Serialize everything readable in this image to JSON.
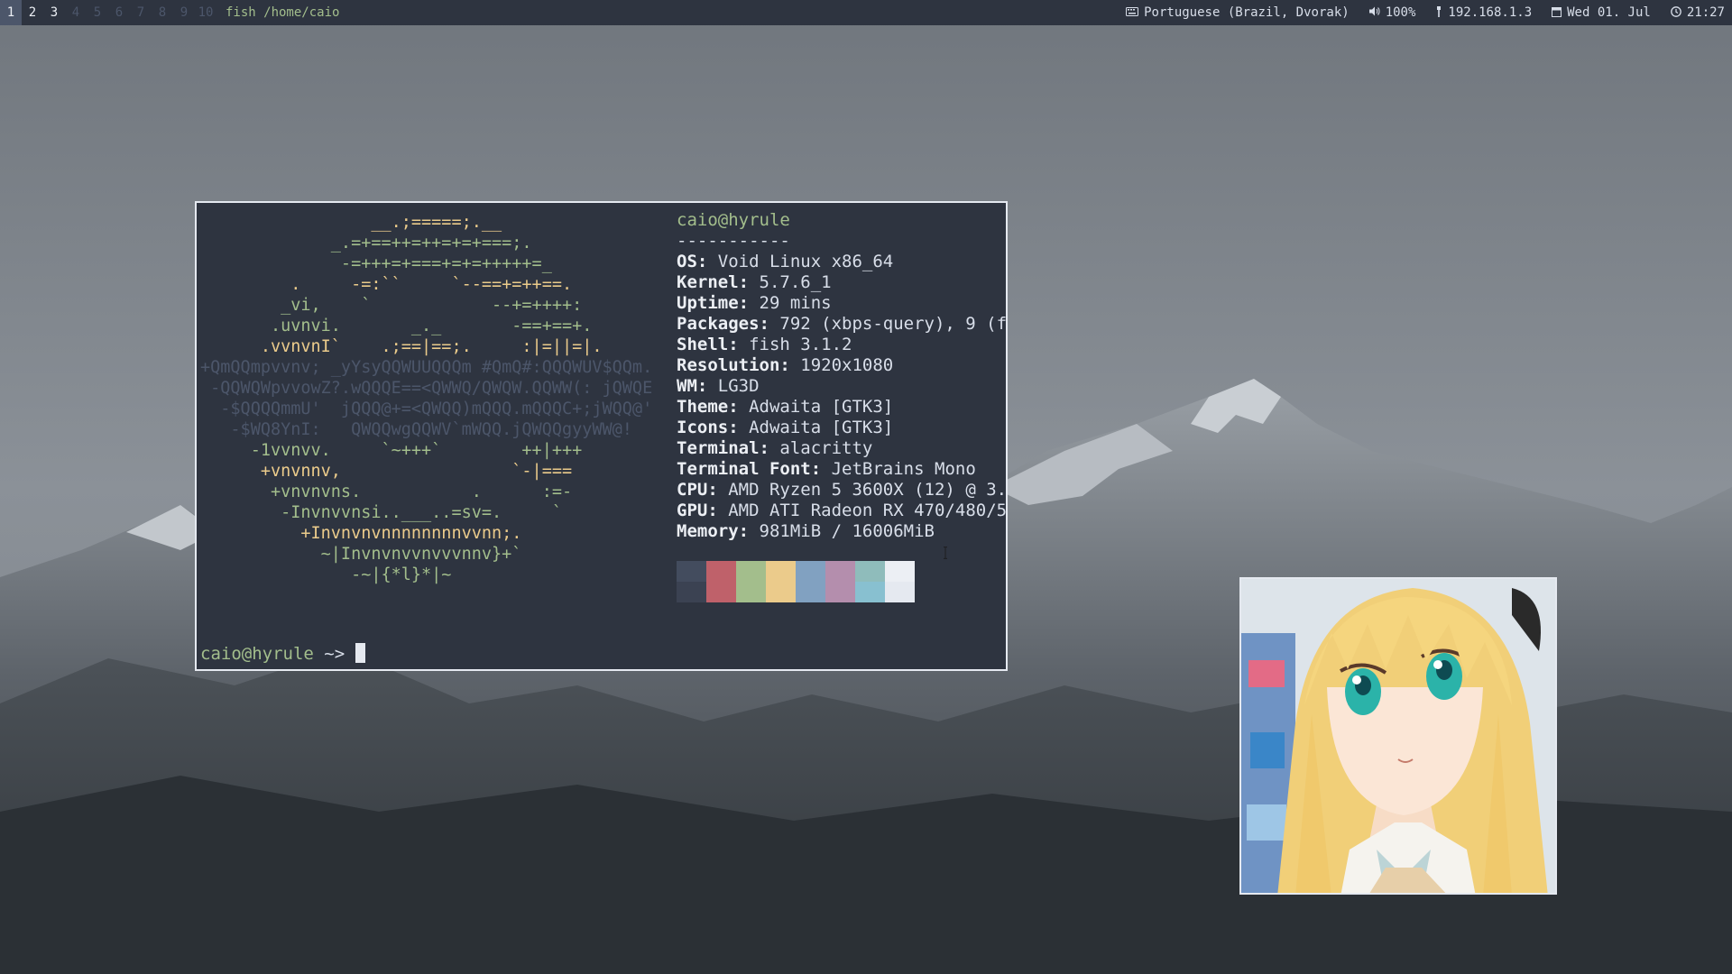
{
  "topbar": {
    "workspaces": [
      "1",
      "2",
      "3",
      "4",
      "5",
      "6",
      "7",
      "8",
      "9",
      "10"
    ],
    "focused_workspace": "1",
    "occupied_workspaces": [
      "2",
      "3"
    ],
    "window_title": "fish /home/caio",
    "keyboard_layout": "Portuguese (Brazil, Dvorak)",
    "volume": "100%",
    "ip": "192.168.1.3",
    "date": "Wed 01. Jul",
    "time": "21:27"
  },
  "terminal": {
    "ascii_lines": [
      "                 __.;=====;.__",
      "             _.=+==++=++=+=+===;.",
      "              -=+++=+===+=+=+++++=_",
      "         .     -=:``     `--==+=++==.",
      "        _vi,    `            --+=++++:",
      "       .uvnvi.       _._       -==+==+.",
      "      .vvnvnI`    .;==|==;.     :|=||=|.",
      "+QmQQmpvvnv; _yYsyQQWUUQQQm #QmQ#:QQQWUV$QQm.",
      " -QQWQWpvvowZ?.wQQQE==<QWWQ/QWQW.QQWW(: jQWQE",
      "  -$QQQQmmU'  jQQQ@+=<QWQQ)mQQQ.mQQQC+;jWQQ@'",
      "   -$WQ8YnI:   QWQQwgQQWV`mWQQ.jQWQQgyyWW@!",
      "     -1vvnvv.     `~+++`        ++|+++",
      "      +vnvnnv,                 `-|===",
      "       +vnvnvns.           .      :=-",
      "        -Invnvvnsi..___..=sv=.     `",
      "          +Invnvnvnnnnnnnnvvnn;.",
      "            ~|Invnvnvvnvvvnnv}+`",
      "               -~|{*l}*|~"
    ],
    "user_host": "caio@hyrule",
    "separator": "-----------",
    "info": [
      {
        "key": "OS",
        "value": "Void Linux x86_64"
      },
      {
        "key": "Kernel",
        "value": "5.7.6_1"
      },
      {
        "key": "Uptime",
        "value": "29 mins"
      },
      {
        "key": "Packages",
        "value": "792 (xbps-query), 9 (f"
      },
      {
        "key": "Shell",
        "value": "fish 3.1.2"
      },
      {
        "key": "Resolution",
        "value": "1920x1080"
      },
      {
        "key": "WM",
        "value": "LG3D"
      },
      {
        "key": "Theme",
        "value": "Adwaita [GTK3]"
      },
      {
        "key": "Icons",
        "value": "Adwaita [GTK3]"
      },
      {
        "key": "Terminal",
        "value": "alacritty"
      },
      {
        "key": "Terminal Font",
        "value": "JetBrains Mono"
      },
      {
        "key": "CPU",
        "value": "AMD Ryzen 5 3600X (12) @ 3."
      },
      {
        "key": "GPU",
        "value": "AMD ATI Radeon RX 470/480/5"
      },
      {
        "key": "Memory",
        "value": "981MiB / 16006MiB"
      }
    ],
    "palette": [
      "#3b4252",
      "#bf616a",
      "#a3be8c",
      "#ebcb8b",
      "#81a1c1",
      "#b48ead",
      "#88c0d0",
      "#e5e9f0"
    ],
    "palette_dark": [
      "#434c5e",
      "#bf616a",
      "#a3be8c",
      "#ebcb8b",
      "#81a1c1",
      "#b48ead",
      "#8fbcbb",
      "#eceff4"
    ],
    "prompt_user": "caio@hyrule",
    "prompt_path": " ~>"
  },
  "colors": {
    "bar_bg": "#2e3440",
    "terminal_bg": "#2e3440",
    "accent_green": "#a3be8c",
    "accent_yellow": "#ebcb8b"
  }
}
